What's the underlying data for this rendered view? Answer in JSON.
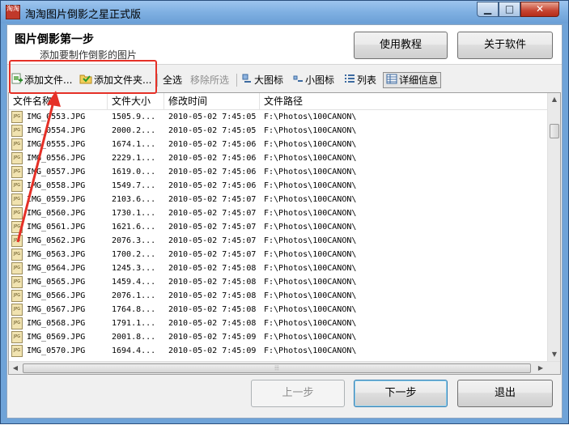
{
  "window": {
    "title": "淘淘图片倒影之星正式版",
    "icon_label": "淘淘"
  },
  "titlebar_buttons": {
    "minimize": "▁",
    "maximize": "□",
    "close": "✕"
  },
  "header": {
    "step_title": "图片倒影第一步",
    "step_subtitle": "添加要制作倒影的图片",
    "help_button": "使用教程",
    "about_button": "关于软件"
  },
  "toolbar": {
    "add_files": "添加文件...",
    "add_folder": "添加文件夹...",
    "select_all": "全选",
    "clear_selection": "移除所选",
    "large_icons": "大图标",
    "small_icons": "小图标",
    "list": "列表",
    "details": "详细信息"
  },
  "table": {
    "columns": [
      "文件名称",
      "文件大小",
      "修改时间",
      "文件路径"
    ],
    "icon_label": "JPG",
    "rows": [
      [
        "IMG_0553.JPG",
        "1505.9...",
        "2010-05-02 7:45:05",
        "F:\\Photos\\100CANON\\"
      ],
      [
        "IMG_0554.JPG",
        "2000.2...",
        "2010-05-02 7:45:05",
        "F:\\Photos\\100CANON\\"
      ],
      [
        "IMG_0555.JPG",
        "1674.1...",
        "2010-05-02 7:45:06",
        "F:\\Photos\\100CANON\\"
      ],
      [
        "IMG_0556.JPG",
        "2229.1...",
        "2010-05-02 7:45:06",
        "F:\\Photos\\100CANON\\"
      ],
      [
        "IMG_0557.JPG",
        "1619.0...",
        "2010-05-02 7:45:06",
        "F:\\Photos\\100CANON\\"
      ],
      [
        "IMG_0558.JPG",
        "1549.7...",
        "2010-05-02 7:45:06",
        "F:\\Photos\\100CANON\\"
      ],
      [
        "IMG_0559.JPG",
        "2103.6...",
        "2010-05-02 7:45:07",
        "F:\\Photos\\100CANON\\"
      ],
      [
        "IMG_0560.JPG",
        "1730.1...",
        "2010-05-02 7:45:07",
        "F:\\Photos\\100CANON\\"
      ],
      [
        "IMG_0561.JPG",
        "1621.6...",
        "2010-05-02 7:45:07",
        "F:\\Photos\\100CANON\\"
      ],
      [
        "IMG_0562.JPG",
        "2076.3...",
        "2010-05-02 7:45:07",
        "F:\\Photos\\100CANON\\"
      ],
      [
        "IMG_0563.JPG",
        "1700.2...",
        "2010-05-02 7:45:07",
        "F:\\Photos\\100CANON\\"
      ],
      [
        "IMG_0564.JPG",
        "1245.3...",
        "2010-05-02 7:45:08",
        "F:\\Photos\\100CANON\\"
      ],
      [
        "IMG_0565.JPG",
        "1459.4...",
        "2010-05-02 7:45:08",
        "F:\\Photos\\100CANON\\"
      ],
      [
        "IMG_0566.JPG",
        "2076.1...",
        "2010-05-02 7:45:08",
        "F:\\Photos\\100CANON\\"
      ],
      [
        "IMG_0567.JPG",
        "1764.8...",
        "2010-05-02 7:45:08",
        "F:\\Photos\\100CANON\\"
      ],
      [
        "IMG_0568.JPG",
        "1791.1...",
        "2010-05-02 7:45:08",
        "F:\\Photos\\100CANON\\"
      ],
      [
        "IMG_0569.JPG",
        "2001.8...",
        "2010-05-02 7:45:09",
        "F:\\Photos\\100CANON\\"
      ],
      [
        "IMG_0570.JPG",
        "1694.4...",
        "2010-05-02 7:45:09",
        "F:\\Photos\\100CANON\\"
      ]
    ]
  },
  "footer": {
    "prev_button": "上一步",
    "next_button": "下一步",
    "exit_button": "退出"
  },
  "colors": {
    "highlight": "#e53027",
    "titlebar": "#7fb0e2"
  }
}
